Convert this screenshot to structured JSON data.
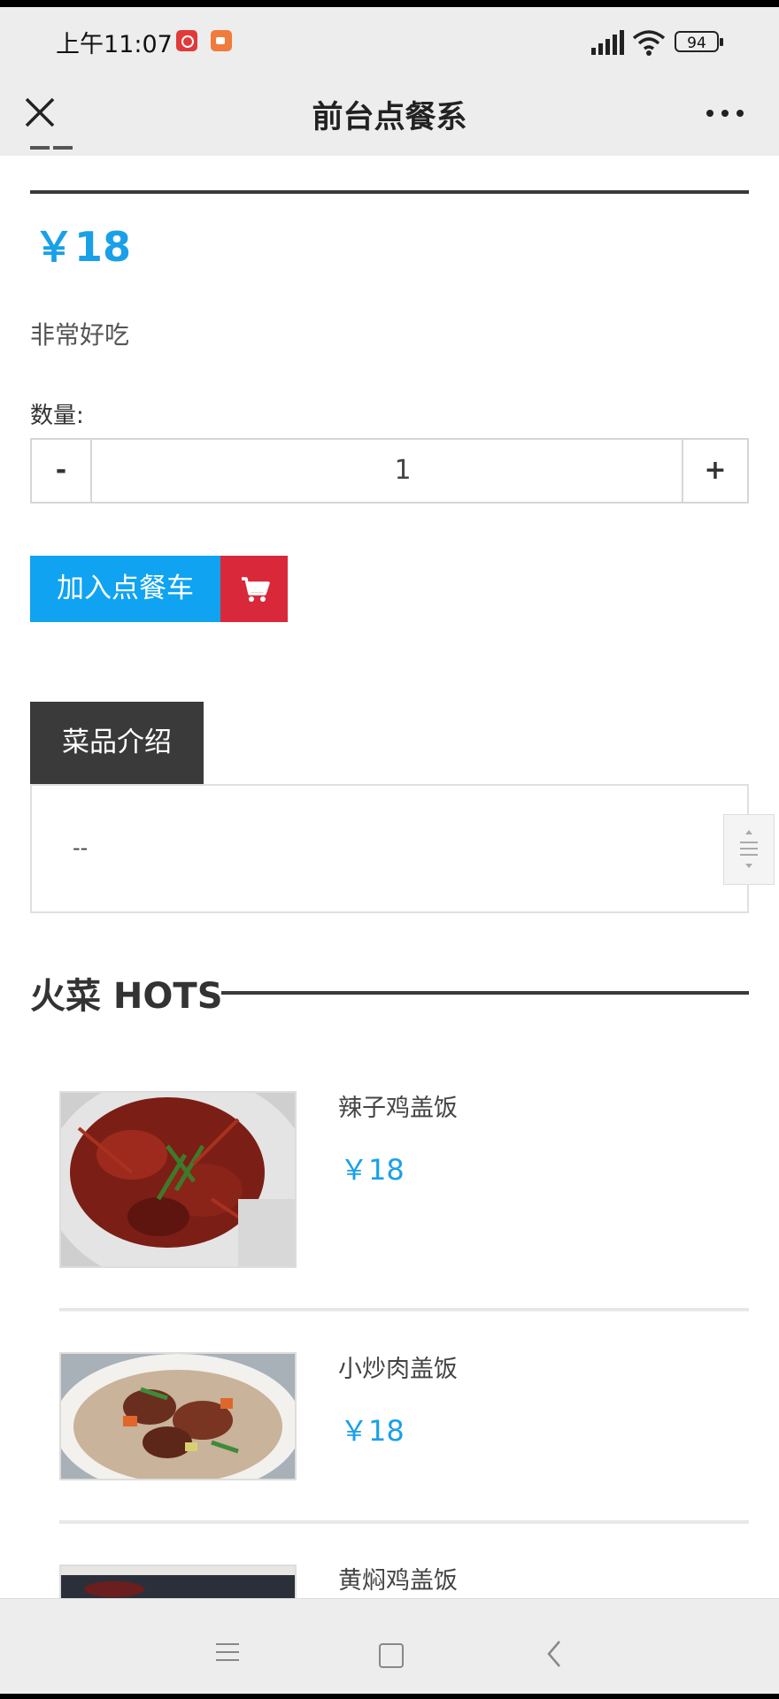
{
  "status_bar": {
    "time": "上午11:07",
    "battery": "94"
  },
  "nav": {
    "title": "前台点餐系"
  },
  "product": {
    "price": "￥18",
    "description": "非常好吃",
    "quantity_label": "数量:",
    "quantity": "1",
    "minus": "-",
    "plus": "+",
    "add_to_cart": "加入点餐车"
  },
  "intro": {
    "tab_label": "菜品介绍",
    "content": "--"
  },
  "hots": {
    "title": "火菜 HOTS",
    "items": [
      {
        "name": "辣子鸡盖饭",
        "price": "￥18"
      },
      {
        "name": "小炒肉盖饭",
        "price": "￥18"
      },
      {
        "name": "黄焖鸡盖饭",
        "price": ""
      }
    ]
  },
  "colors": {
    "accent": "#1aa0e8",
    "cart_red": "#d9283a",
    "dark": "#3a3a3a"
  },
  "icons": [
    "close-icon",
    "more-icon",
    "cart-icon",
    "scroll-handle-icon",
    "menu-icon",
    "home-icon",
    "back-icon"
  ]
}
